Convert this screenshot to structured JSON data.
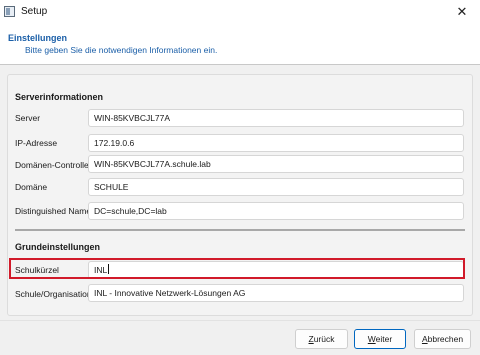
{
  "window": {
    "title": "Setup",
    "close_glyph": "✕"
  },
  "header": {
    "title": "Einstellungen",
    "subtitle": "Bitte geben Sie die notwendigen Informationen ein."
  },
  "server_section": {
    "title": "Serverinformationen",
    "fields": [
      {
        "label": "Server",
        "value": "WIN-85KVBCJL77A"
      },
      {
        "label": "IP-Adresse",
        "value": "172.19.0.6"
      },
      {
        "label": "Domänen-Controller",
        "value": "WIN-85KVBCJL77A.schule.lab"
      },
      {
        "label": "Domäne",
        "value": "SCHULE"
      },
      {
        "label": "Distinguished Name",
        "value": "DC=schule,DC=lab"
      }
    ]
  },
  "basic_section": {
    "title": "Grundeinstellungen",
    "fields": [
      {
        "label": "Schulkürzel",
        "value": "INL"
      },
      {
        "label": "Schule/Organisation",
        "value": "INL - Innovative Netzwerk-Lösungen AG"
      }
    ]
  },
  "buttons": {
    "back": {
      "prefix": "",
      "mnemonic": "Z",
      "suffix": "urück"
    },
    "next": {
      "prefix": "",
      "mnemonic": "W",
      "suffix": "eiter"
    },
    "cancel": {
      "prefix": "",
      "mnemonic": "A",
      "suffix": "bbrechen"
    }
  },
  "colors": {
    "accent": "#0067c0",
    "header_text": "#1b5fa8",
    "highlight": "#d11a2a"
  }
}
